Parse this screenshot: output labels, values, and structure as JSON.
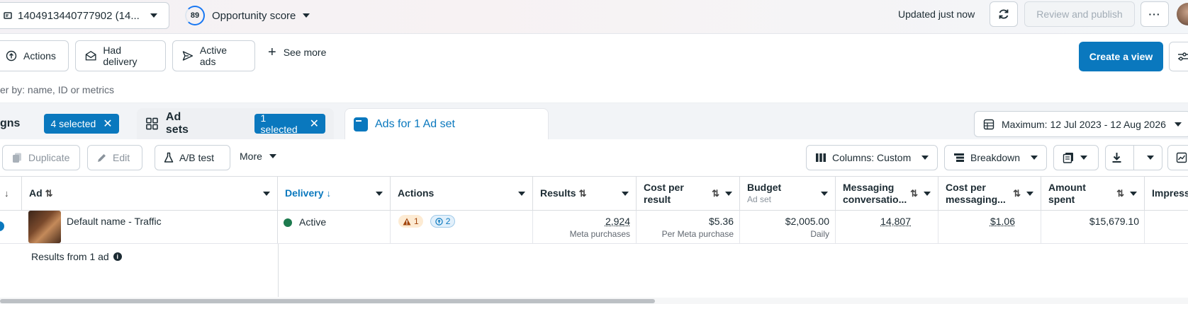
{
  "topbar": {
    "account_label": "1404913440777902 (14...",
    "score_value": "89",
    "score_label": "Opportunity score",
    "updated": "Updated just now",
    "publish": "Review and publish",
    "more": "···"
  },
  "filters": {
    "chips": [
      "Actions",
      "Had delivery",
      "Active ads"
    ],
    "see_more": "See more",
    "create_view": "Create a view"
  },
  "search": {
    "placeholder": "er by: name, ID or metrics"
  },
  "tabs": {
    "campaigns": {
      "label": "gns",
      "badge": "4 selected"
    },
    "adsets": {
      "label": "Ad sets",
      "badge": "1 selected"
    },
    "ads": {
      "label": "Ads for 1 Ad set"
    },
    "date_range": "Maximum: 12 Jul 2023 - 12 Aug 2026"
  },
  "toolbar": {
    "duplicate": "Duplicate",
    "edit": "Edit",
    "ab_test": "A/B test",
    "more": "More",
    "columns": "Columns: Custom",
    "breakdown": "Breakdown"
  },
  "table": {
    "headers": {
      "ad": "Ad",
      "delivery": "Delivery",
      "actions": "Actions",
      "results": "Results",
      "cost_per_result": "Cost per result",
      "budget": "Budget",
      "budget_sub": "Ad set",
      "messaging": "Messaging conversatio...",
      "cost_per_messaging": "Cost per messaging...",
      "amount_spent": "Amount spent",
      "impressions": "Impress"
    },
    "row": {
      "name": "Default name - Traffic",
      "delivery": "Active",
      "warn_count": "1",
      "info_count": "2",
      "results": "2,924",
      "results_sub": "Meta purchases",
      "cost_per_result": "$5.36",
      "cost_per_result_sub": "Per Meta purchase",
      "budget": "$2,005.00",
      "budget_sub": "Daily",
      "messaging": "14,807",
      "cost_per_messaging": "$1.06",
      "amount_spent": "$15,679.10"
    },
    "footer": "Results from 1 ad"
  },
  "colors": {
    "accent": "#0a78be",
    "active": "#1d7a4e"
  }
}
